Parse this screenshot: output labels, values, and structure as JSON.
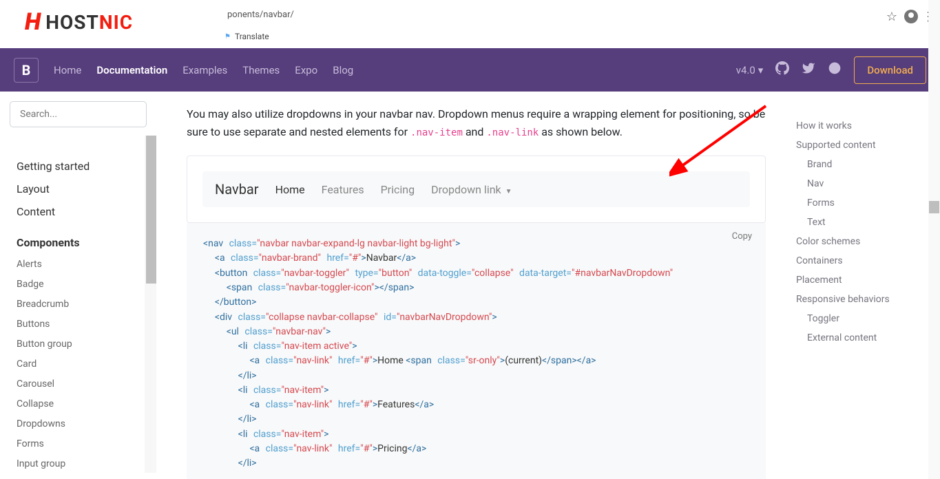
{
  "logo": {
    "text_host": "HOST",
    "text_nic": "NIC"
  },
  "browser": {
    "url_fragment": "ponents/navbar/",
    "translate_label": "Translate"
  },
  "purple_nav": {
    "links": [
      "Home",
      "Documentation",
      "Examples",
      "Themes",
      "Expo",
      "Blog"
    ],
    "active_index": 1,
    "version": "v4.0",
    "download": "Download"
  },
  "sidebar": {
    "search_placeholder": "Search...",
    "sections": [
      "Getting started",
      "Layout",
      "Content"
    ],
    "components_label": "Components",
    "subs": [
      "Alerts",
      "Badge",
      "Breadcrumb",
      "Buttons",
      "Button group",
      "Card",
      "Carousel",
      "Collapse",
      "Dropdowns",
      "Forms",
      "Input group"
    ]
  },
  "content": {
    "intro_1": "You may also utilize dropdowns in your navbar nav. Dropdown menus require a wrapping element for positioning, so be sure to use separate and nested elements for ",
    "intro_code1": ".nav-item",
    "intro_2": " and ",
    "intro_code2": ".nav-link",
    "intro_3": " as shown below.",
    "example_nav": {
      "brand": "Navbar",
      "links": [
        "Home",
        "Features",
        "Pricing",
        "Dropdown link"
      ]
    },
    "copy_label": "Copy",
    "code_text": {
      "l1_navbar_class": "\"navbar navbar-expand-lg navbar-light bg-light\"",
      "l2_brand_class": "\"navbar-brand\"",
      "l2_href": "\"#\"",
      "l2_text": "Navbar",
      "l3_toggler_class": "\"navbar-toggler\"",
      "l3_type": "\"button\"",
      "l3_toggle": "\"collapse\"",
      "l3_target": "\"#navbarNavDropdown\"",
      "l4_icon_class": "\"navbar-toggler-icon\"",
      "l6_collapse_class": "\"collapse navbar-collapse\"",
      "l6_id": "\"navbarNavDropdown\"",
      "l7_ul_class": "\"navbar-nav\"",
      "l8_li_class": "\"nav-item active\"",
      "l9_a_class": "\"nav-link\"",
      "l9_href": "\"#\"",
      "l9_text": "Home ",
      "l9_sr_class": "\"sr-only\"",
      "l9_sr_text": "(current)",
      "l11_li_class": "\"nav-item\"",
      "l12_text": "Features",
      "l15_text": "Pricing"
    }
  },
  "toc": {
    "items": [
      {
        "label": "How it works",
        "sub": false
      },
      {
        "label": "Supported content",
        "sub": false
      },
      {
        "label": "Brand",
        "sub": true
      },
      {
        "label": "Nav",
        "sub": true
      },
      {
        "label": "Forms",
        "sub": true
      },
      {
        "label": "Text",
        "sub": true
      },
      {
        "label": "Color schemes",
        "sub": false
      },
      {
        "label": "Containers",
        "sub": false
      },
      {
        "label": "Placement",
        "sub": false
      },
      {
        "label": "Responsive behaviors",
        "sub": false
      },
      {
        "label": "Toggler",
        "sub": true
      },
      {
        "label": "External content",
        "sub": true
      }
    ]
  }
}
